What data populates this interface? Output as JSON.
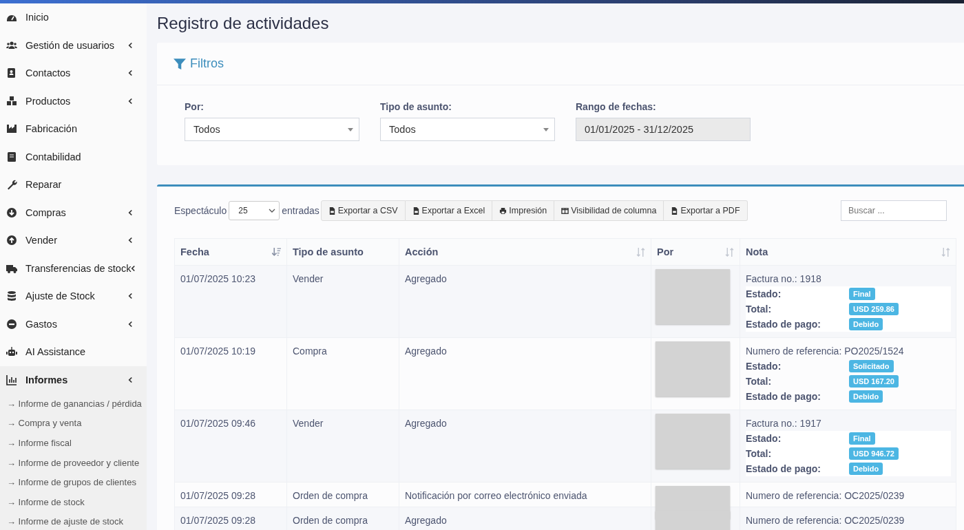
{
  "sidebar": {
    "items": [
      {
        "label": "Inicio",
        "caret": false,
        "selected": false
      },
      {
        "label": "Gestión de usuarios",
        "caret": true,
        "selected": false
      },
      {
        "label": "Contactos",
        "caret": true,
        "selected": false
      },
      {
        "label": "Productos",
        "caret": true,
        "selected": false
      },
      {
        "label": "Fabricación",
        "caret": false,
        "selected": false
      },
      {
        "label": "Contabilidad",
        "caret": false,
        "selected": false
      },
      {
        "label": "Reparar",
        "caret": false,
        "selected": false
      },
      {
        "label": "Compras",
        "caret": true,
        "selected": false
      },
      {
        "label": "Vender",
        "caret": true,
        "selected": false
      },
      {
        "label": "Transferencias de stock",
        "caret": true,
        "selected": false
      },
      {
        "label": "Ajuste de Stock",
        "caret": true,
        "selected": false
      },
      {
        "label": "Gastos",
        "caret": true,
        "selected": false
      },
      {
        "label": "AI Assistance",
        "caret": false,
        "selected": false
      },
      {
        "label": "Informes",
        "caret": true,
        "selected": true,
        "children": [
          {
            "label": "→ Informe de ganancias / pérdida"
          },
          {
            "label": "→ Compra y venta"
          },
          {
            "label": "→ Informe fiscal"
          },
          {
            "label": "→ Informe de proveedor y cliente"
          },
          {
            "label": "→ Informe de grupos de clientes"
          },
          {
            "label": "→ Informe de stock"
          },
          {
            "label": "→ Informe de ajuste de stock"
          }
        ]
      }
    ]
  },
  "page_title": "Registro de actividades",
  "filters": {
    "title": "Filtros",
    "fields": [
      {
        "label": "Por:",
        "value": "Todos",
        "kind": "select"
      },
      {
        "label": "Tipo de asunto:",
        "value": "Todos",
        "kind": "select"
      },
      {
        "label": "Rango de fechas:",
        "value": "01/01/2025 - 31/12/2025",
        "kind": "readonly"
      }
    ]
  },
  "toolbar": {
    "show_label": "Espectáculo",
    "page_size": "25",
    "entries_label": "entradas",
    "search_placeholder": "Buscar ...",
    "buttons": [
      {
        "label": "Exportar a CSV"
      },
      {
        "label": "Exportar a Excel"
      },
      {
        "label": "Impresión"
      },
      {
        "label": "Visibilidad de columna"
      },
      {
        "label": "Exportar a PDF"
      }
    ]
  },
  "table": {
    "columns": [
      {
        "label": "Fecha"
      },
      {
        "label": "Tipo de asunto"
      },
      {
        "label": "Acción"
      },
      {
        "label": "Por"
      },
      {
        "label": "Nota"
      }
    ],
    "rows": [
      {
        "date": "01/07/2025 10:23",
        "type": "Vender",
        "action": "Agregado",
        "note": "Factura no.: 1918",
        "details": [
          {
            "label": "Estado:",
            "badge": "Final"
          },
          {
            "label": "Total:",
            "badge": "USD 259.86"
          },
          {
            "label": "Estado de pago:",
            "badge": "Debido"
          }
        ]
      },
      {
        "date": "01/07/2025 10:19",
        "type": "Compra",
        "action": "Agregado",
        "note": "Numero de referencia: PO2025/1524",
        "details": [
          {
            "label": "Estado:",
            "badge": "Solicitado"
          },
          {
            "label": "Total:",
            "badge": "USD 167.20"
          },
          {
            "label": "Estado de pago:",
            "badge": "Debido"
          }
        ]
      },
      {
        "date": "01/07/2025 09:46",
        "type": "Vender",
        "action": "Agregado",
        "note": "Factura no.: 1917",
        "details": [
          {
            "label": "Estado:",
            "badge": "Final"
          },
          {
            "label": "Total:",
            "badge": "USD 946.72"
          },
          {
            "label": "Estado de pago:",
            "badge": "Debido"
          }
        ]
      },
      {
        "date": "01/07/2025 09:28",
        "type": "Orden de compra",
        "action": "Notificación por correo electrónico enviada",
        "note": "Numero de referencia: OC2025/0239"
      },
      {
        "date": "01/07/2025 09:28",
        "type": "Orden de compra",
        "action": "Agregado",
        "note": "Numero de referencia: OC2025/0239"
      }
    ]
  }
}
